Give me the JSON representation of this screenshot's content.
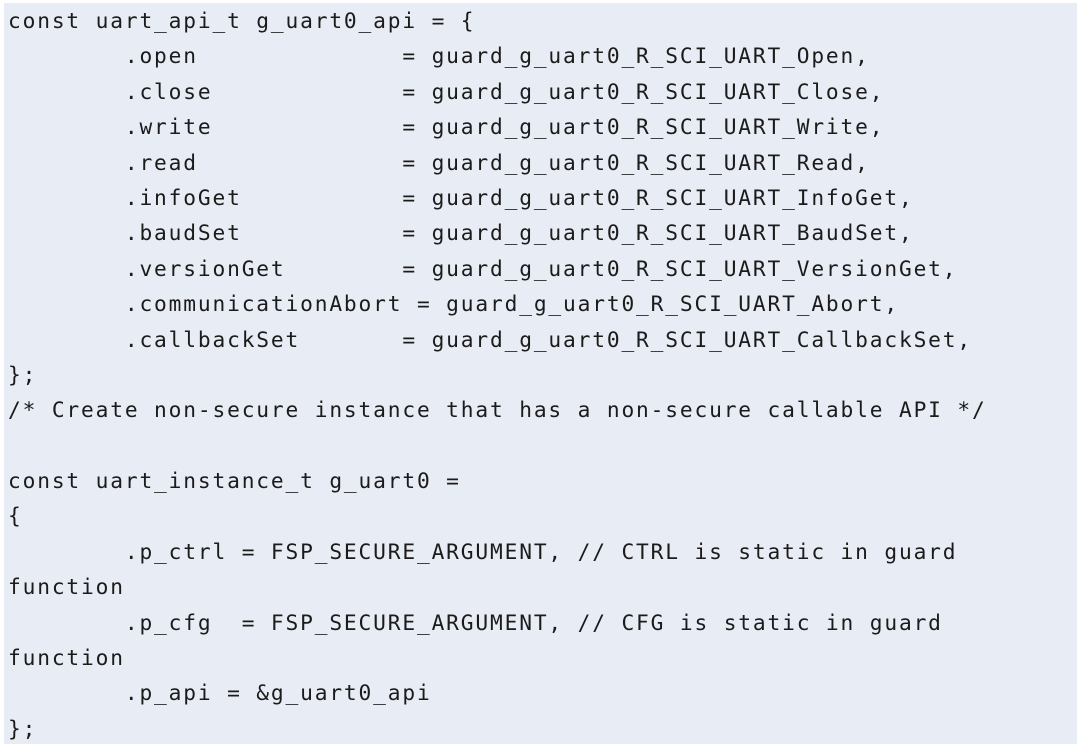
{
  "document": {
    "kind": "source-code-listing",
    "language": "c",
    "background_color": "#e8ecf4",
    "text_color": "#1b1b1b",
    "border_color": "#ffffff"
  },
  "code": {
    "full_text": "const uart_api_t g_uart0_api = {\n        .open              = guard_g_uart0_R_SCI_UART_Open,\n        .close             = guard_g_uart0_R_SCI_UART_Close,\n        .write             = guard_g_uart0_R_SCI_UART_Write,\n        .read              = guard_g_uart0_R_SCI_UART_Read,\n        .infoGet           = guard_g_uart0_R_SCI_UART_InfoGet,\n        .baudSet           = guard_g_uart0_R_SCI_UART_BaudSet,\n        .versionGet        = guard_g_uart0_R_SCI_UART_VersionGet,\n        .communicationAbort = guard_g_uart0_R_SCI_UART_Abort,\n        .callbackSet       = guard_g_uart0_R_SCI_UART_CallbackSet,\n};\n/* Create non-secure instance that has a non-secure callable API */\n\nconst uart_instance_t g_uart0 =\n{\n        .p_ctrl = FSP_SECURE_ARGUMENT, // CTRL is static in guard\nfunction\n        .p_cfg  = FSP_SECURE_ARGUMENT, // CFG is static in guard\nfunction\n        .p_api = &g_uart0_api\n};",
    "lines": [
      "const uart_api_t g_uart0_api = {",
      "        .open              = guard_g_uart0_R_SCI_UART_Open,",
      "        .close             = guard_g_uart0_R_SCI_UART_Close,",
      "        .write             = guard_g_uart0_R_SCI_UART_Write,",
      "        .read              = guard_g_uart0_R_SCI_UART_Read,",
      "        .infoGet           = guard_g_uart0_R_SCI_UART_InfoGet,",
      "        .baudSet           = guard_g_uart0_R_SCI_UART_BaudSet,",
      "        .versionGet        = guard_g_uart0_R_SCI_UART_VersionGet,",
      "        .communicationAbort = guard_g_uart0_R_SCI_UART_Abort,",
      "        .callbackSet       = guard_g_uart0_R_SCI_UART_CallbackSet,",
      "};",
      "/* Create non-secure instance that has a non-secure callable API */",
      "",
      "const uart_instance_t g_uart0 =",
      "{",
      "        .p_ctrl = FSP_SECURE_ARGUMENT, // CTRL is static in guard",
      "function",
      "        .p_cfg  = FSP_SECURE_ARGUMENT, // CFG is static in guard",
      "function",
      "        .p_api = &g_uart0_api",
      "};"
    ],
    "struct_api": {
      "declaration": "const uart_api_t g_uart0_api = {",
      "members": [
        {
          "field": ".open",
          "value": "guard_g_uart0_R_SCI_UART_Open,"
        },
        {
          "field": ".close",
          "value": "guard_g_uart0_R_SCI_UART_Close,"
        },
        {
          "field": ".write",
          "value": "guard_g_uart0_R_SCI_UART_Write,"
        },
        {
          "field": ".read",
          "value": "guard_g_uart0_R_SCI_UART_Read,"
        },
        {
          "field": ".infoGet",
          "value": "guard_g_uart0_R_SCI_UART_InfoGet,"
        },
        {
          "field": ".baudSet",
          "value": "guard_g_uart0_R_SCI_UART_BaudSet,"
        },
        {
          "field": ".versionGet",
          "value": "guard_g_uart0_R_SCI_UART_VersionGet,"
        },
        {
          "field": ".communicationAbort",
          "value": "guard_g_uart0_R_SCI_UART_Abort,"
        },
        {
          "field": ".callbackSet",
          "value": "guard_g_uart0_R_SCI_UART_CallbackSet,"
        }
      ],
      "terminator": "};"
    },
    "comment": "/* Create non-secure instance that has a non-secure callable API */",
    "struct_instance": {
      "declaration": "const uart_instance_t g_uart0 =",
      "open_brace": "{",
      "members": [
        {
          "field": ".p_ctrl",
          "value": "FSP_SECURE_ARGUMENT,",
          "trailing_comment": "// CTRL is static in guard function"
        },
        {
          "field": ".p_cfg",
          "value": "FSP_SECURE_ARGUMENT,",
          "trailing_comment": "// CFG is static in guard function"
        },
        {
          "field": ".p_api",
          "value": "&g_uart0_api",
          "trailing_comment": ""
        }
      ],
      "terminator": "};"
    }
  }
}
